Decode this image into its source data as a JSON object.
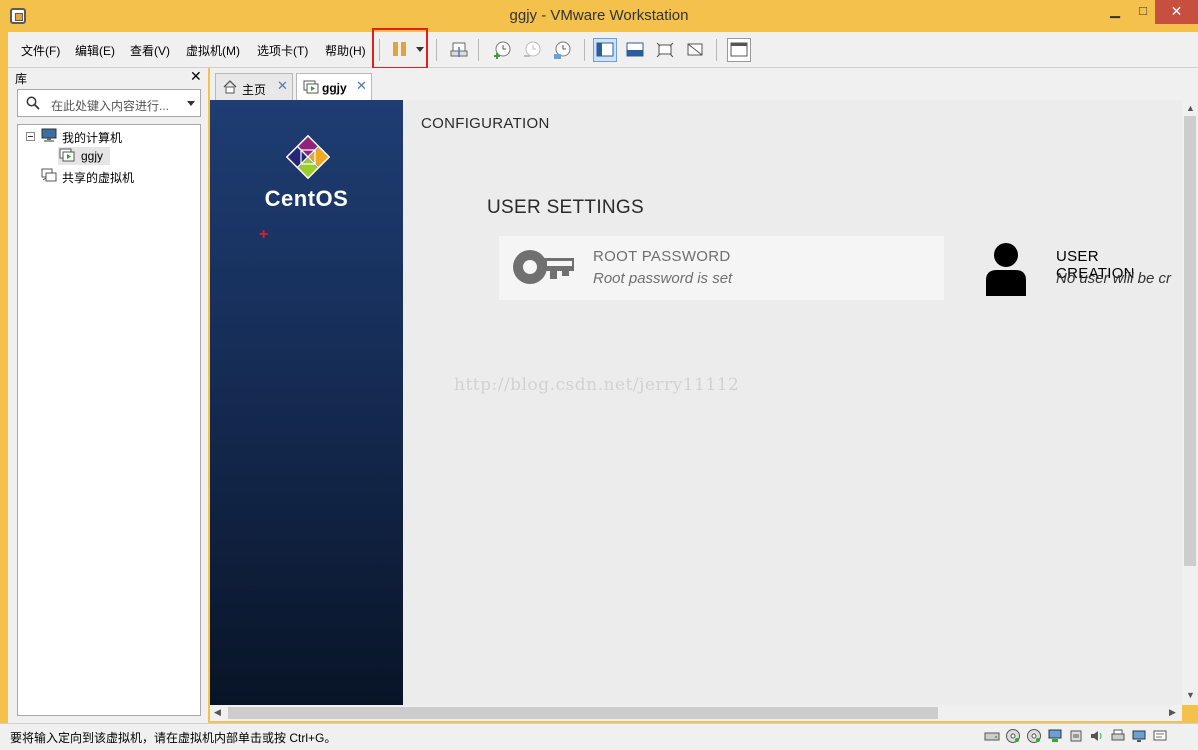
{
  "window": {
    "title": "ggjy - VMware Workstation",
    "min": "▁",
    "max": "□",
    "close": "✕"
  },
  "menu": [
    {
      "label": "文件(F)"
    },
    {
      "label": "编辑(E)"
    },
    {
      "label": "查看(V)"
    },
    {
      "label": "虚拟机(M)"
    },
    {
      "label": "选项卡(T)"
    },
    {
      "label": "帮助(H)"
    }
  ],
  "library": {
    "title": "库",
    "close": "✕",
    "search_placeholder": "在此处键入内容进行...",
    "tree": [
      {
        "label": "我的计算机",
        "icon": "computer-icon"
      },
      {
        "label": "ggjy",
        "icon": "vm-icon"
      },
      {
        "label": "共享的虚拟机",
        "icon": "shared-vm-icon"
      }
    ]
  },
  "tabs": [
    {
      "label": "主页",
      "icon": "home-icon",
      "close": "✕"
    },
    {
      "label": "ggjy",
      "icon": "vm-icon",
      "close": "✕"
    }
  ],
  "vm": {
    "brand": "CentOS",
    "section_title": "CONFIGURATION",
    "subsection_title": "USER SETTINGS",
    "root_password": {
      "title": "ROOT PASSWORD",
      "status": "Root password is set"
    },
    "user_creation": {
      "title": "USER CREATION",
      "status": "No user will be cr"
    },
    "watermark": "http://blog.csdn.net/jerry11112",
    "red_mark": "+"
  },
  "status": {
    "text": "要将输入定向到该虚拟机，请在虚拟机内部单击或按 Ctrl+G。"
  },
  "colors": {
    "frame": "#f4c24c",
    "highlight_box": "#e41c1c",
    "pause": "#e3a23c",
    "sidebar_top": "#1f3d73",
    "sidebar_bottom": "#081426"
  }
}
